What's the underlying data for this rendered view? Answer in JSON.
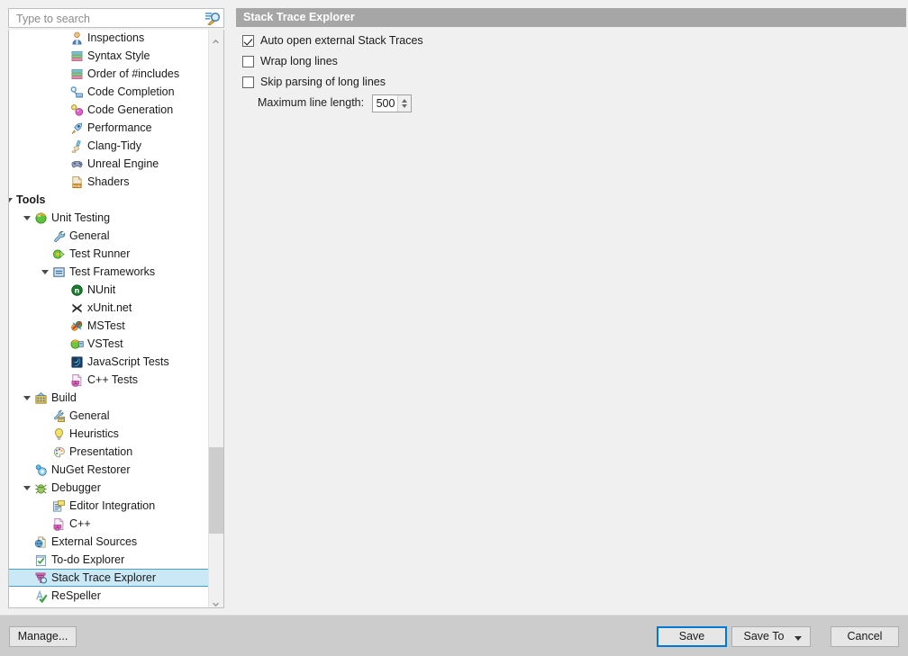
{
  "search": {
    "placeholder": "Type to search",
    "value": ""
  },
  "tree": {
    "items": [
      {
        "label": "Inspections",
        "indent": 3,
        "icon": "inspections-icon",
        "expander": "none",
        "bold": false,
        "selected": false
      },
      {
        "label": "Syntax Style",
        "indent": 3,
        "icon": "syntax-style-icon",
        "expander": "none",
        "bold": false,
        "selected": false
      },
      {
        "label": "Order of #includes",
        "indent": 3,
        "icon": "includes-order-icon",
        "expander": "none",
        "bold": false,
        "selected": false
      },
      {
        "label": "Code Completion",
        "indent": 3,
        "icon": "code-completion-icon",
        "expander": "none",
        "bold": false,
        "selected": false
      },
      {
        "label": "Code Generation",
        "indent": 3,
        "icon": "code-generation-icon",
        "expander": "none",
        "bold": false,
        "selected": false
      },
      {
        "label": "Performance",
        "indent": 3,
        "icon": "performance-icon",
        "expander": "none",
        "bold": false,
        "selected": false
      },
      {
        "label": "Clang-Tidy",
        "indent": 3,
        "icon": "clang-tidy-icon",
        "expander": "none",
        "bold": false,
        "selected": false
      },
      {
        "label": "Unreal Engine",
        "indent": 3,
        "icon": "unreal-engine-icon",
        "expander": "none",
        "bold": false,
        "selected": false
      },
      {
        "label": "Shaders",
        "indent": 3,
        "icon": "shaders-icon",
        "expander": "none",
        "bold": false,
        "selected": false
      },
      {
        "label": "Tools",
        "indent": 0,
        "icon": "none",
        "expander": "expanded",
        "bold": true,
        "selected": false
      },
      {
        "label": "Unit Testing",
        "indent": 1,
        "icon": "unit-testing-icon",
        "expander": "expanded",
        "bold": false,
        "selected": false
      },
      {
        "label": "General",
        "indent": 2,
        "icon": "wrench-icon",
        "expander": "none",
        "bold": false,
        "selected": false
      },
      {
        "label": "Test Runner",
        "indent": 2,
        "icon": "test-runner-icon",
        "expander": "none",
        "bold": false,
        "selected": false
      },
      {
        "label": "Test Frameworks",
        "indent": 2,
        "icon": "test-frameworks-icon",
        "expander": "expanded",
        "bold": false,
        "selected": false
      },
      {
        "label": "NUnit",
        "indent": 3,
        "icon": "nunit-icon",
        "expander": "none",
        "bold": false,
        "selected": false
      },
      {
        "label": "xUnit.net",
        "indent": 3,
        "icon": "xunit-icon",
        "expander": "none",
        "bold": false,
        "selected": false
      },
      {
        "label": "MSTest",
        "indent": 3,
        "icon": "mstest-icon",
        "expander": "none",
        "bold": false,
        "selected": false
      },
      {
        "label": "VSTest",
        "indent": 3,
        "icon": "vstest-icon",
        "expander": "none",
        "bold": false,
        "selected": false
      },
      {
        "label": "JavaScript Tests",
        "indent": 3,
        "icon": "javascript-tests-icon",
        "expander": "none",
        "bold": false,
        "selected": false
      },
      {
        "label": "C++ Tests",
        "indent": 3,
        "icon": "cpp-tests-icon",
        "expander": "none",
        "bold": false,
        "selected": false
      },
      {
        "label": "Build",
        "indent": 1,
        "icon": "build-icon",
        "expander": "expanded",
        "bold": false,
        "selected": false
      },
      {
        "label": "General",
        "indent": 2,
        "icon": "build-general-icon",
        "expander": "none",
        "bold": false,
        "selected": false
      },
      {
        "label": "Heuristics",
        "indent": 2,
        "icon": "heuristics-icon",
        "expander": "none",
        "bold": false,
        "selected": false
      },
      {
        "label": "Presentation",
        "indent": 2,
        "icon": "presentation-icon",
        "expander": "none",
        "bold": false,
        "selected": false
      },
      {
        "label": "NuGet Restorer",
        "indent": 1,
        "icon": "nuget-icon",
        "expander": "none",
        "bold": false,
        "selected": false
      },
      {
        "label": "Debugger",
        "indent": 1,
        "icon": "debugger-icon",
        "expander": "expanded",
        "bold": false,
        "selected": false
      },
      {
        "label": "Editor Integration",
        "indent": 2,
        "icon": "editor-integration-icon",
        "expander": "none",
        "bold": false,
        "selected": false
      },
      {
        "label": "C++",
        "indent": 2,
        "icon": "cpp-icon",
        "expander": "none",
        "bold": false,
        "selected": false
      },
      {
        "label": "External Sources",
        "indent": 1,
        "icon": "external-sources-icon",
        "expander": "none",
        "bold": false,
        "selected": false
      },
      {
        "label": "To-do Explorer",
        "indent": 1,
        "icon": "todo-explorer-icon",
        "expander": "none",
        "bold": false,
        "selected": false
      },
      {
        "label": "Stack Trace Explorer",
        "indent": 1,
        "icon": "stack-trace-icon",
        "expander": "none",
        "bold": false,
        "selected": true
      },
      {
        "label": "ReSpeller",
        "indent": 1,
        "icon": "respeller-icon",
        "expander": "none",
        "bold": false,
        "selected": false
      }
    ]
  },
  "panel": {
    "title": "Stack Trace Explorer",
    "options": [
      {
        "label": "Auto open external Stack Traces",
        "checked": true,
        "name": "auto-open-external-stack-traces"
      },
      {
        "label": "Wrap long lines",
        "checked": false,
        "name": "wrap-long-lines"
      },
      {
        "label": "Skip parsing of long lines",
        "checked": false,
        "name": "skip-parsing-of-long-lines"
      }
    ],
    "max_line_length_label": "Maximum line length:",
    "max_line_length_value": "500"
  },
  "footer": {
    "manage_label": "Manage...",
    "save_label": "Save",
    "save_to_label": "Save To",
    "cancel_label": "Cancel"
  },
  "colors": {
    "accent": "#0078d7",
    "selection_fill": "#cbe8f6",
    "selection_border": "#4a9fc7",
    "header_band": "#a6a6a6",
    "footer_bg": "#cccccc",
    "dialog_bg": "#f0f0f0"
  }
}
